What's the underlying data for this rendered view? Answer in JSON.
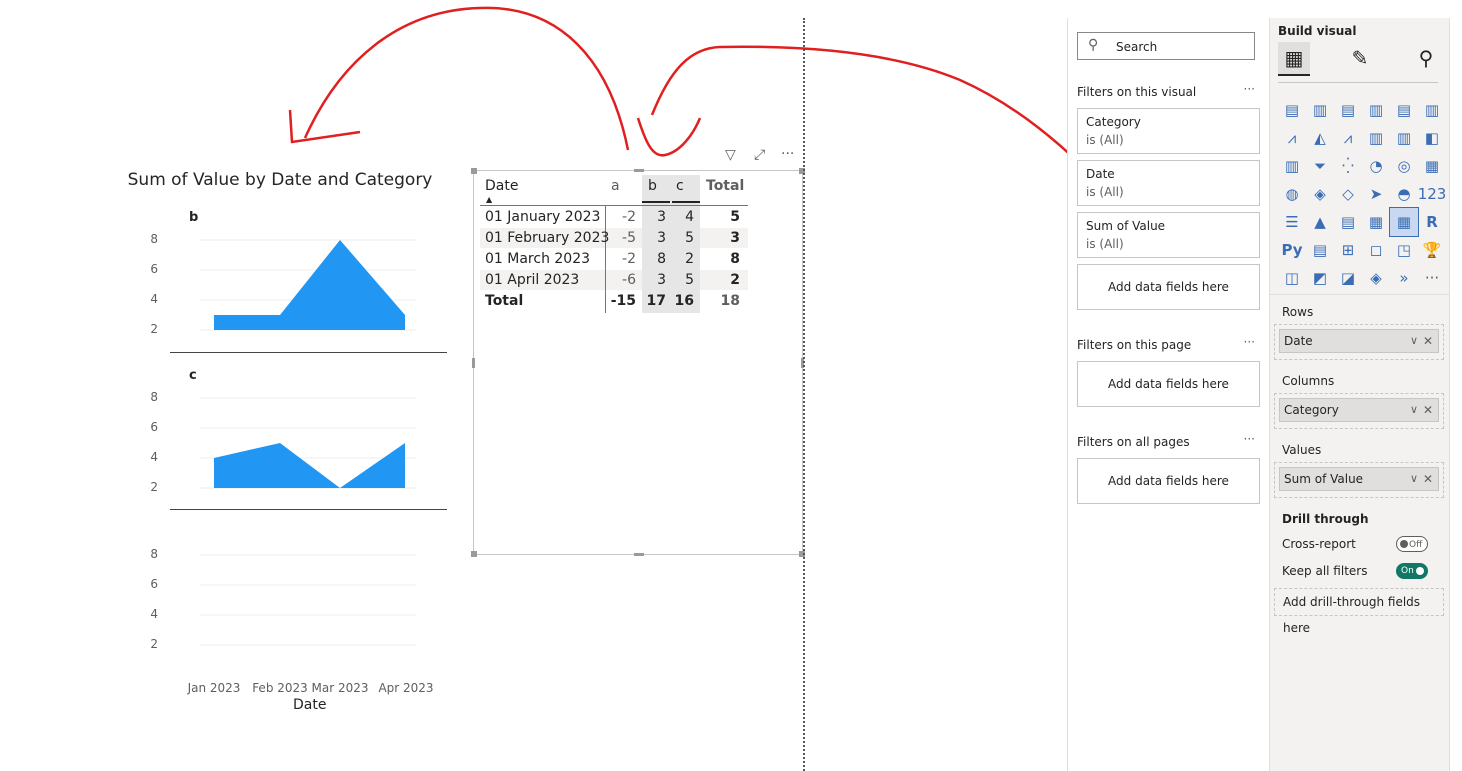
{
  "chart": {
    "title": "Sum of Value by Date and Category",
    "xlabel": "Date",
    "yticks": [
      "8",
      "6",
      "4",
      "2"
    ],
    "xticks": [
      "Jan 2023",
      "Feb 2023",
      "Mar 2023",
      "Apr 2023"
    ]
  },
  "chart_data": {
    "type": "area",
    "title": "Sum of Value by Date and Category",
    "xlabel": "Date",
    "ylabel": "",
    "categories": [
      "Jan 2023",
      "Feb 2023",
      "Mar 2023",
      "Apr 2023"
    ],
    "ylim": [
      2,
      8
    ],
    "series": [
      {
        "name": "b",
        "values": [
          3,
          3,
          8,
          3
        ]
      },
      {
        "name": "c",
        "values": [
          4,
          5,
          2,
          5
        ]
      }
    ],
    "color": "#2196F3",
    "grid": true
  },
  "matrix": {
    "headers": {
      "date": "Date",
      "a": "a",
      "b": "b",
      "c": "c",
      "total": "Total"
    },
    "rows": [
      {
        "date": "01 January 2023",
        "a": "-2",
        "b": "3",
        "c": "4",
        "total": "5"
      },
      {
        "date": "01 February 2023",
        "a": "-5",
        "b": "3",
        "c": "5",
        "total": "3"
      },
      {
        "date": "01 March 2023",
        "a": "-2",
        "b": "8",
        "c": "2",
        "total": "8"
      },
      {
        "date": "01 April 2023",
        "a": "-6",
        "b": "3",
        "c": "5",
        "total": "2"
      }
    ],
    "total": {
      "date": "Total",
      "a": "-15",
      "b": "17",
      "c": "16",
      "total": "18"
    }
  },
  "visual_header": {
    "filter": "▽",
    "focus": "⤢",
    "more": "···"
  },
  "filters": {
    "search_placeholder": "Search",
    "on_visual_label": "Filters on this visual",
    "cards": [
      {
        "name": "Category",
        "state": "is (All)"
      },
      {
        "name": "Date",
        "state": "is (All)"
      },
      {
        "name": "Sum of Value",
        "state": "is (All)"
      }
    ],
    "add_fields": "Add data fields here",
    "on_page_label": "Filters on this page",
    "on_all_pages_label": "Filters on all pages",
    "more": "···"
  },
  "viz": {
    "title": "Build visual",
    "rows_label": "Rows",
    "rows_field": "Date",
    "columns_label": "Columns",
    "columns_field": "Category",
    "values_label": "Values",
    "values_field": "Sum of Value",
    "drill_label": "Drill through",
    "cross_report_label": "Cross-report",
    "cross_report_state": "Off",
    "keep_filters_label": "Keep all filters",
    "keep_filters_state": "On",
    "add_drill": "Add drill-through fields here",
    "icons": [
      "stacked-bar-icon",
      "stacked-column-icon",
      "clustered-bar-icon",
      "clustered-column-icon",
      "100-bar-icon",
      "100-column-icon",
      "line-icon",
      "area-icon",
      "stacked-area-icon",
      "line-column-icon",
      "line-clustered-icon",
      "ribbon-icon",
      "waterfall-icon",
      "funnel-icon",
      "scatter-icon",
      "pie-icon",
      "donut-icon",
      "treemap-icon",
      "map-icon",
      "filled-map-icon",
      "shape-map-icon",
      "azure-map-icon",
      "gauge-icon",
      "card-icon",
      "multirow-card-icon",
      "kpi-icon",
      "slicer-icon",
      "table-icon",
      "matrix-icon",
      "r-visual-icon",
      "python-visual-icon",
      "key-influencers-icon",
      "decomposition-tree-icon",
      "qa-icon",
      "narrative-icon",
      "goals-icon",
      "paginated-icon",
      "power-apps-icon",
      "power-automate-icon",
      "diamond-icon",
      "chevron-icon",
      "more-visuals-icon"
    ],
    "icon_glyphs": [
      "▤",
      "▥",
      "▤",
      "▥",
      "▤",
      "▥",
      "⩘",
      "◭",
      "⩘",
      "▥",
      "▥",
      "◧",
      "▥",
      "⏷",
      "⁛",
      "◔",
      "◎",
      "▦",
      "◍",
      "◈",
      "◇",
      "➤",
      "◓",
      "123",
      "☰",
      "▲",
      "▤",
      "▦",
      "▦",
      "R",
      "Py",
      "▤",
      "⊞",
      "◻",
      "◳",
      "🏆",
      "◫",
      "◩",
      "◪",
      "◈",
      "»",
      "···"
    ]
  }
}
